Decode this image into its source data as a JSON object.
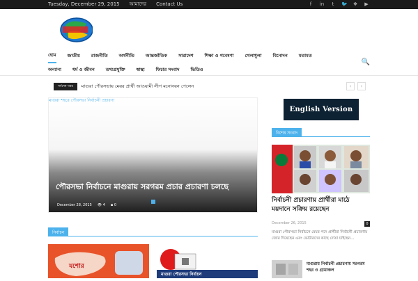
{
  "topbar": {
    "date": "Tuesday, December 29, 2015",
    "about": "আমাদের",
    "contact": "Contact Us",
    "social": [
      "f",
      "in",
      "t",
      "🐦",
      "❖",
      "▶"
    ]
  },
  "nav": {
    "row1": [
      "হোম",
      "জাতীয়",
      "রাজনীতি",
      "অর্থনীতি",
      "আন্তর্জাতিক",
      "সারাদেশ",
      "শিক্ষা ও গবেষণা",
      "খেলাধুলা",
      "বিনোদন",
      "মতামত"
    ],
    "row2": [
      "অন্যান্য",
      "ধর্ম ও জীবন",
      "তথ্যপ্রযুক্তি",
      "স্বাস্থ্য",
      "ফিচার সংবাদ",
      "ভিডিও"
    ]
  },
  "ticker": {
    "tag": "সর্বশেষ খবর",
    "headline": "মাগুরা পৌরসভায় মেয়র প্রার্থী আওয়ামী লীগ মনোনয়ন পেলেন"
  },
  "feature": {
    "caption": "মাগুরা শহরে পৌরসভা নির্বাচনী প্রচারণা",
    "title": "পৌরসভা নির্বাচনে মাগুরায় সরগরম প্রচার প্রচারণা চলছে",
    "date": "December 28, 2015",
    "views": "4",
    "comments": "0"
  },
  "block": {
    "header": "নির্বাচন"
  },
  "sidebar": {
    "english_version": "English Version",
    "header": "বিশেষ সংবাদ",
    "title": "নির্বাচনী প্রচারণায় প্রার্থীরা মাঠে ময়দানে সক্রিয় রয়েছেন",
    "date": "December 26, 2015",
    "comments": "0",
    "excerpt": "মাগুরা পৌরসভা নির্বাচনে মেয়র পদে প্রার্থীরা নির্বাচনী প্রচারণায় জোর দিয়েছেন এবং ভোটারদের কাছে দোয়া চাইছেন...",
    "mini_title": "মাগুরায় নির্বাচনী প্রচারণায় সরগরম শহর ও গ্রামাঞ্চল"
  },
  "thumb2": {
    "label": "মাগুরা পৌরসভা নির্বাচন"
  },
  "thumb1": {
    "label": "যশোর"
  }
}
